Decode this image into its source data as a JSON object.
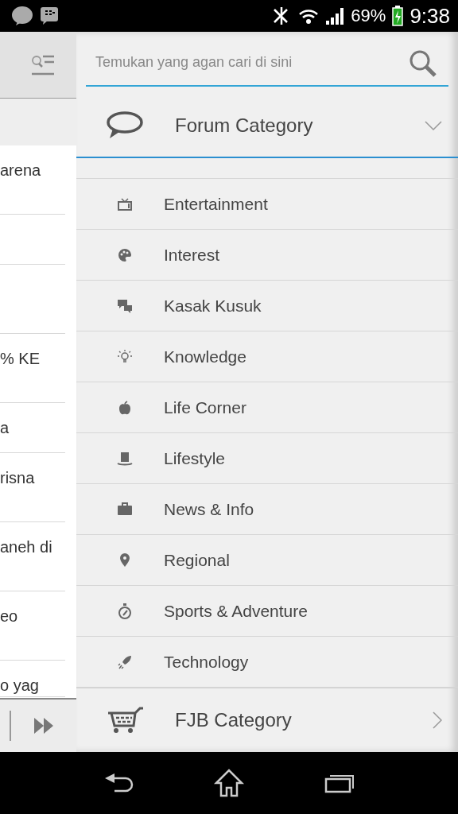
{
  "status_bar": {
    "battery": "69%",
    "time": "9:38"
  },
  "left_panel": {
    "rows": [
      "arena",
      "",
      "",
      "% KE",
      "a",
      "risna",
      "aneh di",
      "eo",
      "o yag"
    ]
  },
  "search": {
    "placeholder": "Temukan yang agan cari di sini"
  },
  "forum_category": {
    "title": "Forum Category",
    "expanded": true,
    "items": [
      {
        "label": "Entertainment"
      },
      {
        "label": "Interest"
      },
      {
        "label": "Kasak Kusuk"
      },
      {
        "label": "Knowledge"
      },
      {
        "label": "Life Corner"
      },
      {
        "label": "Lifestyle"
      },
      {
        "label": "News & Info"
      },
      {
        "label": "Regional"
      },
      {
        "label": "Sports & Adventure"
      },
      {
        "label": "Technology"
      }
    ]
  },
  "fjb_category": {
    "title": "FJB Category",
    "expanded": false
  }
}
